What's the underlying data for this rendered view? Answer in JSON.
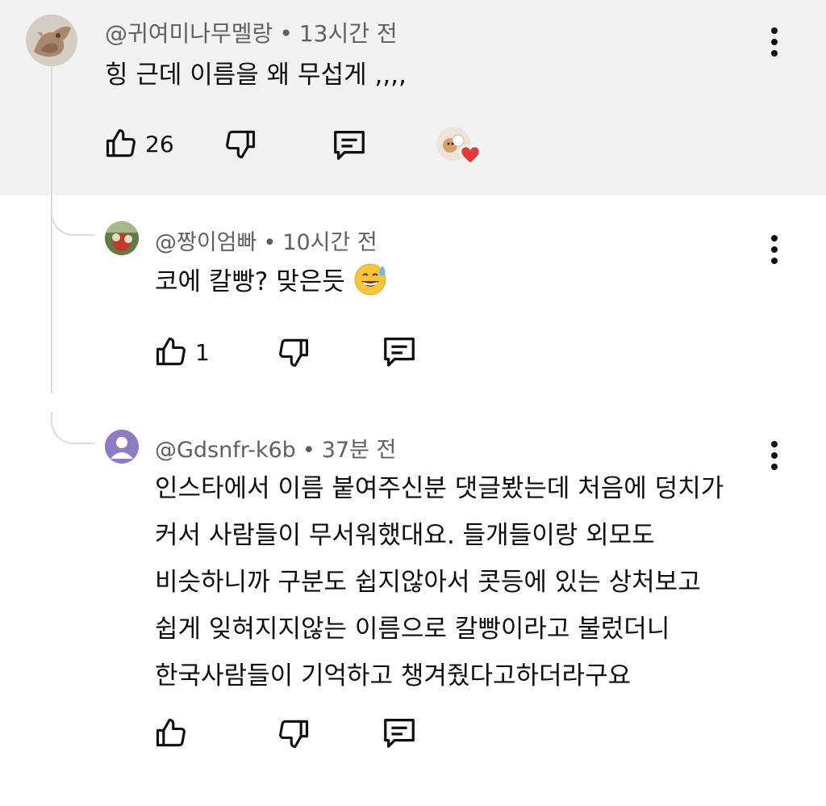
{
  "comments": [
    {
      "author": "@귀여미나무멜랑",
      "time": "13시간 전",
      "text": "힝   근데 이름을 왜 무섭게 ,,,,",
      "likes": "26",
      "creator_heart": true
    },
    {
      "author": "@짱이엄빠",
      "time": "10시간 전",
      "text": "코에 칼빵? 맞은듯",
      "emoji": "😅",
      "likes": "1"
    },
    {
      "author": "@Gdsnfr-k6b",
      "time": "37분 전",
      "lines": [
        "인스타에서 이름 붙여주신분 댓글봤는데 처음에 덩치가",
        "커서 사람들이 무서워했대요. 들개들이랑 외모도",
        "비슷하니까 구분도 쉽지않아서 콧등에 있는 상처보고",
        "쉽게 잊혀지지않는 이름으로 칼빵이라고 불렀더니",
        "한국사람들이 기억하고 챙겨줬다고하더라구요"
      ],
      "likes": ""
    }
  ],
  "ui": {
    "separator": "•",
    "accent_heart": "#e53935",
    "highlight_bg": "#f2f2f2",
    "default_avatar_bg": "#8e7cc3"
  }
}
